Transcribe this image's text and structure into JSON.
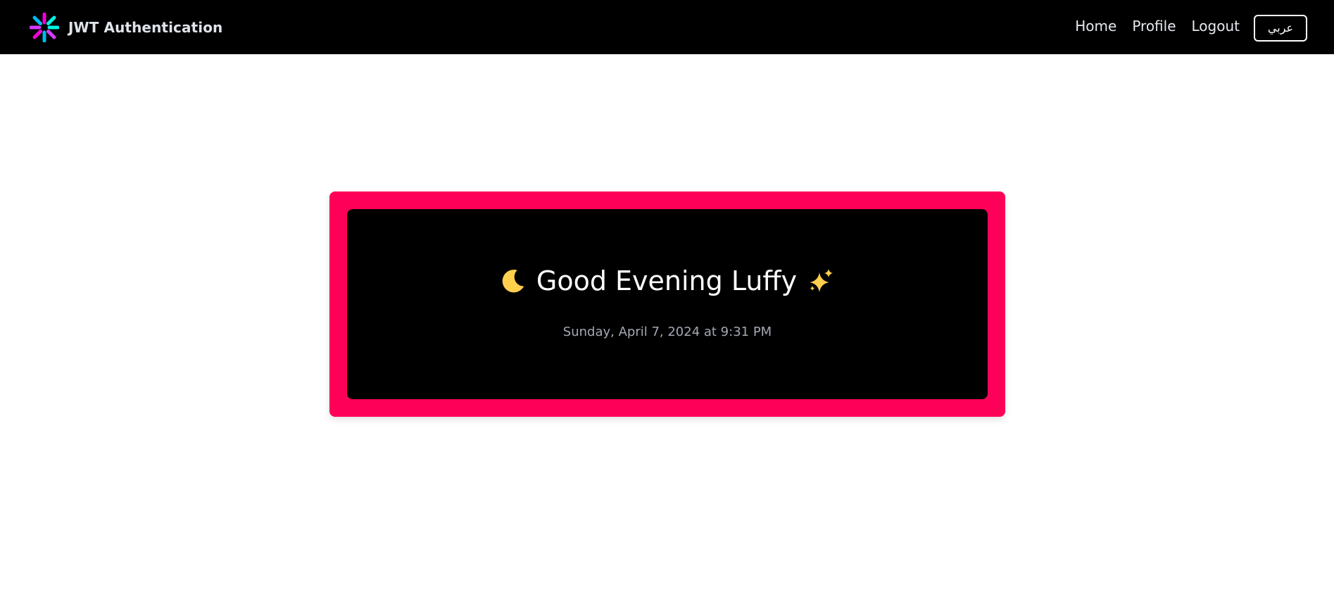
{
  "navbar": {
    "brand_title": "JWT Authentication",
    "logo_icon": "jwt-logo-icon",
    "links": [
      {
        "label": "Home"
      },
      {
        "label": "Profile"
      },
      {
        "label": "Logout"
      }
    ],
    "language_button": "عربي"
  },
  "card": {
    "greeting_icon_left": "crescent-moon-icon",
    "greeting_text": "Good Evening Luffy",
    "greeting_icon_right": "sparkles-icon",
    "datetime": "Sunday, April 7, 2024 at 9:31 PM"
  },
  "colors": {
    "navbar_bg": "#000000",
    "card_border": "#ff0059",
    "card_bg": "#000000",
    "emoji_yellow": "#ffcf4d"
  }
}
